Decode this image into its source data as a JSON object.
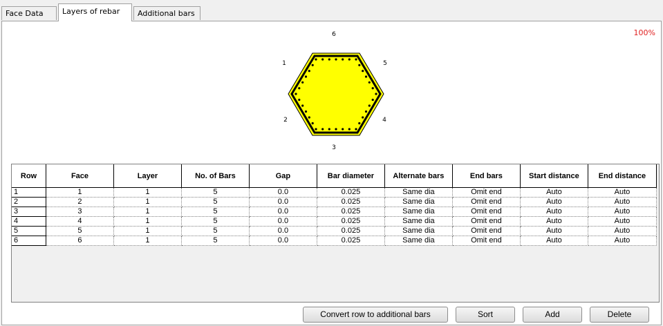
{
  "tabs": [
    {
      "label": "Face Data",
      "active": false
    },
    {
      "label": "Layers of rebar",
      "active": true
    },
    {
      "label": "Additional bars",
      "active": false
    }
  ],
  "zoom_label": "100%",
  "section": {
    "face_labels": [
      "1",
      "2",
      "3",
      "4",
      "5",
      "6"
    ],
    "fill_color": "#ffff00",
    "outline_color": "#000000"
  },
  "grid": {
    "columns": [
      "Row",
      "Face",
      "Layer",
      "No. of Bars",
      "Gap",
      "Bar diameter",
      "Alternate bars",
      "End bars",
      "Start distance",
      "End distance"
    ],
    "rows": [
      [
        "1",
        "1",
        "1",
        "5",
        "0.0",
        "0.025",
        "Same dia",
        "Omit end",
        "Auto",
        "Auto"
      ],
      [
        "2",
        "2",
        "1",
        "5",
        "0.0",
        "0.025",
        "Same dia",
        "Omit end",
        "Auto",
        "Auto"
      ],
      [
        "3",
        "3",
        "1",
        "5",
        "0.0",
        "0.025",
        "Same dia",
        "Omit end",
        "Auto",
        "Auto"
      ],
      [
        "4",
        "4",
        "1",
        "5",
        "0.0",
        "0.025",
        "Same dia",
        "Omit end",
        "Auto",
        "Auto"
      ],
      [
        "5",
        "5",
        "1",
        "5",
        "0.0",
        "0.025",
        "Same dia",
        "Omit end",
        "Auto",
        "Auto"
      ],
      [
        "6",
        "6",
        "1",
        "5",
        "0.0",
        "0.025",
        "Same dia",
        "Omit end",
        "Auto",
        "Auto"
      ]
    ]
  },
  "buttons": {
    "convert": "Convert row to additional bars",
    "sort": "Sort",
    "add": "Add",
    "delete": "Delete"
  }
}
